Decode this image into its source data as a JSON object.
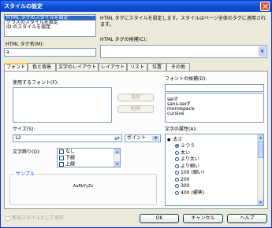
{
  "window": {
    "title": "スタイルの設定"
  },
  "style_kind_list": {
    "items": [
      "HTML タグのスタイルを設定",
      "クラスのスタイルを設定",
      "ID のスタイルを設定"
    ],
    "selected_index": 0
  },
  "description": "HTML タグにスタイルを設定します。スタイルはページ全体のタグに適用されます。",
  "tag_name": {
    "label": "HTML タグ名(M):",
    "value": "a"
  },
  "tag_candidates": {
    "label": "HTML タグの候補(C):",
    "value": ""
  },
  "tabs": [
    "フォント",
    "色と背景",
    "文字のレイアウト",
    "レイアウト",
    "リスト",
    "位置",
    "その他"
  ],
  "active_tab": 0,
  "font_tab": {
    "fonts_label": "使用するフォント(F):",
    "add_button": "追加",
    "remove_button": "削除",
    "font_candidates_label": "フォントの候補(D):",
    "font_candidates_input": "",
    "font_candidates": [
      "serif",
      "sans-serif",
      "monospace",
      "cursive"
    ],
    "size_label": "サイズ(S):",
    "size_value": "12",
    "size_unit": "ポイント",
    "decoration_label": "文字飾り(O):",
    "decoration_options": [
      "なし",
      "下線",
      "上線"
    ],
    "attributes_label": "文字の属性(A):",
    "attributes_group_label": "太さ",
    "attributes": [
      "ふつう",
      "太い",
      "より太い",
      "より細い",
      "100 (細い)",
      "200",
      "300",
      "400 (標準)"
    ],
    "sample_label": "サンプル",
    "sample_text": "AaBbYyZz"
  },
  "new_style_checkbox": "新規スタイルとして保存",
  "buttons": {
    "ok": "OK",
    "cancel": "キャンセル",
    "help": "ヘルプ"
  }
}
